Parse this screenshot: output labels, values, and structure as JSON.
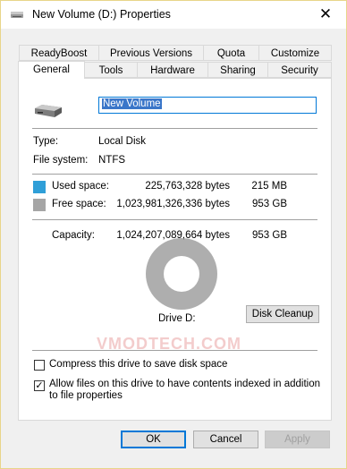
{
  "window": {
    "title": "New Volume (D:) Properties",
    "close_glyph": "✕"
  },
  "tabs_row1": [
    "ReadyBoost",
    "Previous Versions",
    "Quota",
    "Customize"
  ],
  "tabs_row2": [
    "General",
    "Tools",
    "Hardware",
    "Sharing",
    "Security"
  ],
  "general": {
    "volume_name": "New Volume",
    "type_label": "Type:",
    "type_value": "Local Disk",
    "fs_label": "File system:",
    "fs_value": "NTFS",
    "used_label": "Used space:",
    "used_bytes": "225,763,328 bytes",
    "used_size": "215 MB",
    "free_label": "Free space:",
    "free_bytes": "1,023,981,326,336 bytes",
    "free_size": "953 GB",
    "capacity_label": "Capacity:",
    "capacity_bytes": "1,024,207,089,664 bytes",
    "capacity_size": "953 GB",
    "drive_label": "Drive D:",
    "cleanup_button": "Disk Cleanup",
    "compress_label": "Compress this drive to save disk space",
    "compress_checked": false,
    "index_label": "Allow files on this drive to have contents indexed in addition to file properties",
    "index_checked": true,
    "check_glyph": "✓",
    "watermark_text": "VMODTECH.COM"
  },
  "footer": {
    "ok": "OK",
    "cancel": "Cancel",
    "apply": "Apply"
  },
  "colors": {
    "used": "#2f9fd8",
    "free": "#a6a6a6",
    "accent": "#0078d7"
  }
}
